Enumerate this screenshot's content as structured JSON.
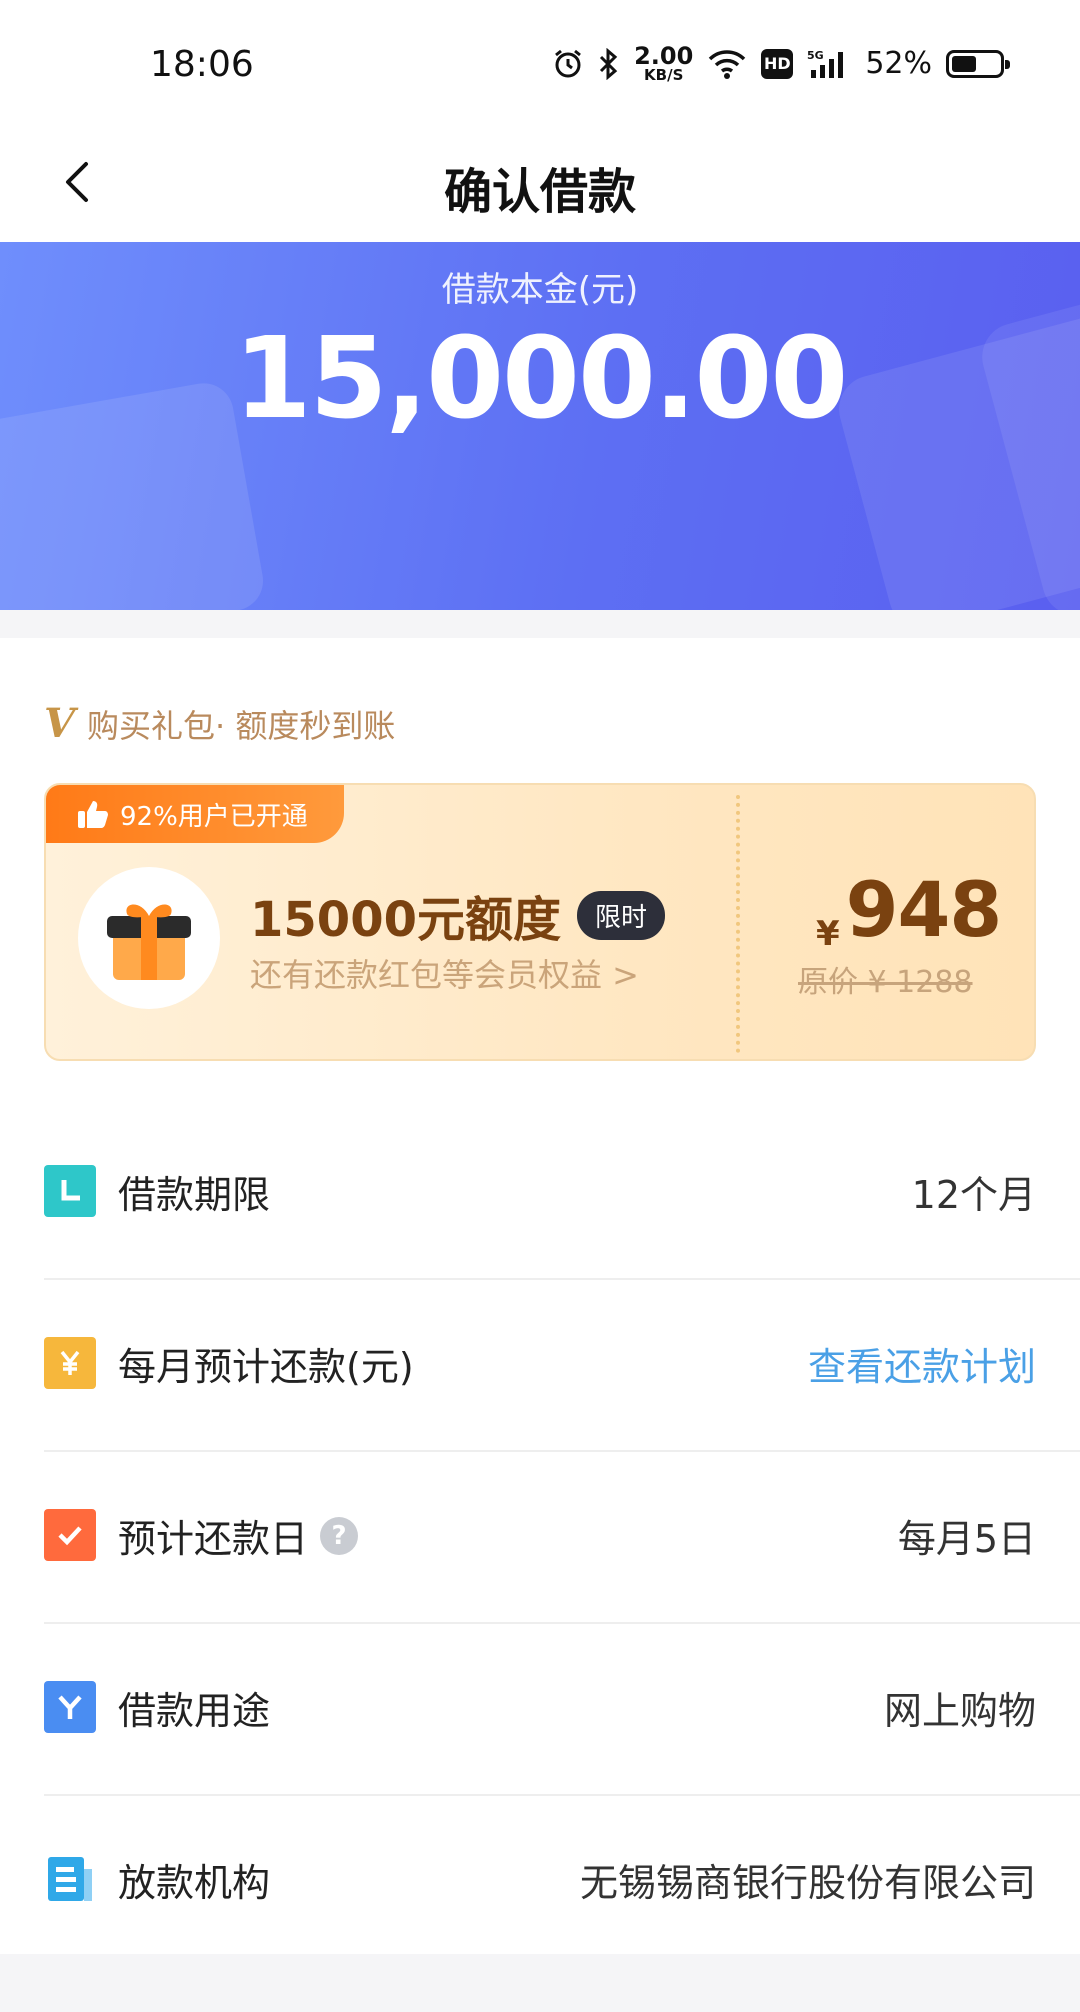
{
  "status_bar": {
    "time": "18:06",
    "speed_value": "2.00",
    "speed_unit": "KB/S",
    "hd": "HD",
    "network": "5G",
    "battery_percent": "52%",
    "battery_level": 0.52,
    "icons": [
      "alarm-icon",
      "bluetooth-icon",
      "wifi-icon",
      "hd-icon",
      "signal-icon",
      "battery-icon"
    ]
  },
  "nav": {
    "back_icon": "chevron-left-icon",
    "title": "确认借款"
  },
  "hero": {
    "label": "借款本金(元)",
    "amount": "15,000.00"
  },
  "promo": {
    "header_mark": "V",
    "header_text": "购买礼包· 额度秒到账",
    "badge_text": "92%用户已开通",
    "title": "15000元额度",
    "tag": "限时",
    "subtitle": "还有还款红包等会员权益 >",
    "currency": "¥",
    "price": "948",
    "original_price": "原价 ¥ 1288"
  },
  "details": [
    {
      "icon": "clock-icon",
      "icon_color": "#2ec7c9",
      "label": "借款期限",
      "value": "12个月",
      "value_link": false
    },
    {
      "icon": "yuan-icon",
      "icon_color": "#f6b73c",
      "label": "每月预计还款(元)",
      "value": "查看还款计划",
      "value_link": true
    },
    {
      "icon": "check-icon",
      "icon_color": "#ff6a3d",
      "label": "预计还款日",
      "value": "每月5日",
      "value_link": false,
      "help": "?"
    },
    {
      "icon": "purpose-icon",
      "icon_color": "#4a8df2",
      "label": "借款用途",
      "value": "网上购物",
      "value_link": false
    },
    {
      "icon": "document-icon",
      "icon_color": "#2fa8e8",
      "label": "放款机构",
      "value": "无锡锡商银行股份有限公司",
      "value_link": false
    }
  ]
}
